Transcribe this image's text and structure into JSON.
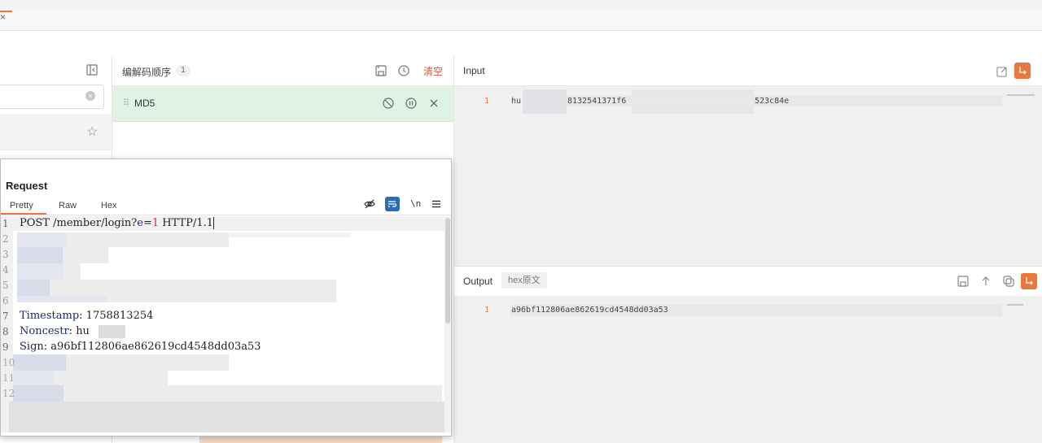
{
  "tab": {
    "close_glyph": "×"
  },
  "left": {
    "clear_glyph": "×",
    "star_glyph": "☆"
  },
  "decoder": {
    "title": "编解码顺序",
    "count": "1",
    "clear_label": "清空",
    "step": {
      "grip": "⠿",
      "name": "MD5"
    }
  },
  "request": {
    "title": "Request",
    "tabs": [
      "Pretty",
      "Raw",
      "Hex"
    ],
    "active_tab": "Pretty",
    "newline_label": "\\n",
    "line_numbers": [
      "1",
      "2",
      "3",
      "4",
      "5",
      "6",
      "7",
      "8",
      "9",
      "10",
      "11",
      "12"
    ],
    "request_line": {
      "method_path": "POST /member/login?",
      "param_name": "e",
      "equals": "=",
      "param_value": "1",
      "version": " HTTP/1.1"
    },
    "headers": [
      {
        "name": "Timestamp",
        "sep": ": ",
        "value": "1758813254"
      },
      {
        "name": "Noncestr",
        "sep": ": ",
        "value": "hu"
      },
      {
        "name": "Sign",
        "sep": ": ",
        "value": "a96bf112806ae862619cd4548dd03a53"
      }
    ]
  },
  "input": {
    "title": "Input",
    "line_number": "1",
    "fragments": [
      "hu",
      "8132541371f6",
      "523c84e"
    ]
  },
  "output": {
    "title": "Output",
    "hex_toggle": "hex原文",
    "line_number": "1",
    "value": "a96bf112806ae862619cd4548dd03a53"
  },
  "colors": {
    "accent": "#e8793a",
    "clear": "#e2533f",
    "selected_step": "#def3e4",
    "header_name": "#1b2a6b"
  },
  "icons": [
    "close-icon",
    "sidebar-collapse-icon",
    "clear-search-icon",
    "star-icon",
    "save-icon",
    "history-icon",
    "drag-handle-icon",
    "disable-icon",
    "pause-icon",
    "remove-icon",
    "hide-icon",
    "wrap-icon",
    "newline-icon",
    "menu-icon",
    "edit-icon",
    "word-wrap-icon",
    "export-icon",
    "copy-icon"
  ]
}
